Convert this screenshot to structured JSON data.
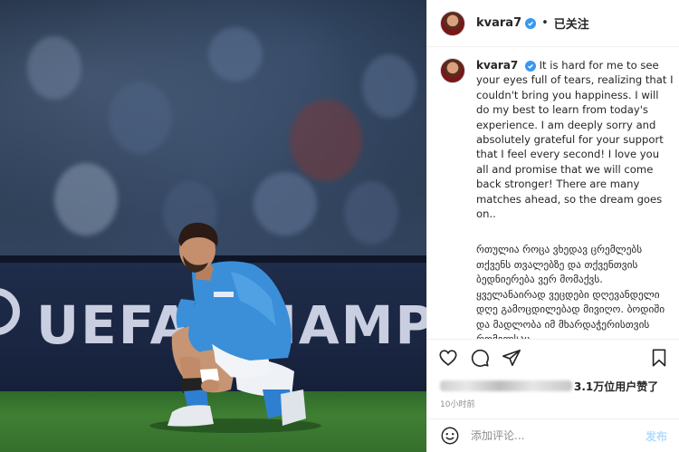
{
  "post": {
    "username": "kvara7",
    "follow_status": "已关注",
    "caption_en": "It is hard for me to see your eyes full of tears, realizing that I couldn't bring you happiness. I will do my best to learn from today's experience. I am deeply sorry and absolutely grateful for your support that I feel every second! I love you all and promise that we will come back stronger! There are many matches ahead, so the dream goes on..",
    "caption_ka": "რთულია როცა ვხედავ ცრემლებს თქვენს თვალებზე და თქვენთვის ბედნიერება ვერ მომაქვს. ყველანაირად ვეცდები დღევანდელი დღე გამოცდილებად მივიღო. ბოდიში და მადლობა იმ მხარდაჭერისთვის რომელსაც",
    "likes_text": "3.1万位用户赞了",
    "time": "10小时前",
    "comment_placeholder": "添加评论...",
    "post_button": "发布"
  },
  "photo": {
    "board_text": "UEFA CHAMPIO"
  },
  "icons": {
    "verified": "verified-badge-icon",
    "like": "heart-icon",
    "comment": "comment-icon",
    "share": "paper-plane-icon",
    "save": "bookmark-icon",
    "emoji": "smiley-icon"
  },
  "colors": {
    "verified": "#3897f0",
    "jersey": "#3a8fd8",
    "post_button": "#b3dbff"
  }
}
